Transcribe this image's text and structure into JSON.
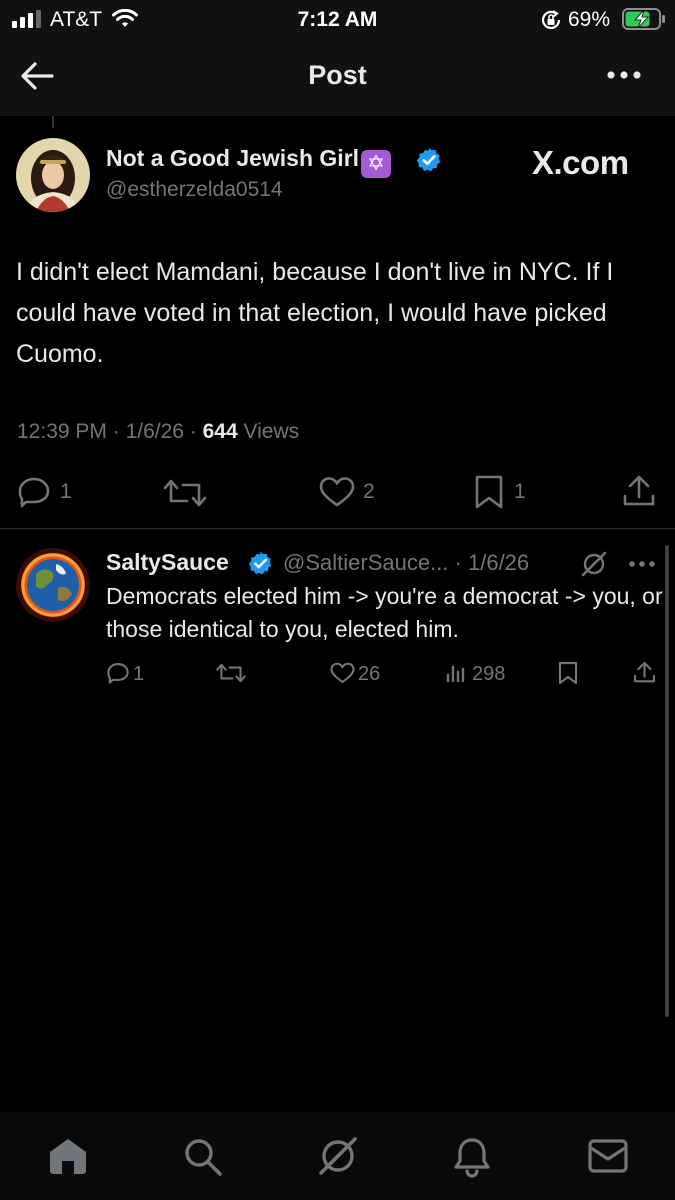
{
  "status_bar": {
    "carrier": "AT&T",
    "time": "7:12 AM",
    "battery_percent": "69%"
  },
  "header": {
    "title": "Post"
  },
  "post": {
    "display_name": "Not a Good Jewish Girl",
    "name_emoji": "✡",
    "handle": "@estherzelda0514",
    "watermark": "X.com",
    "text": "I didn't elect Mamdani, because I don't live in NYC. If I could have voted in that election, I would have picked Cuomo.",
    "time": "12:39 PM",
    "date": "1/6/26",
    "views_count": "644",
    "views_label": "Views",
    "actions": {
      "replies": "1",
      "likes": "2",
      "bookmarks": "1"
    }
  },
  "reply": {
    "display_name": "SaltySauce",
    "handle": "@SaltierSauce...",
    "date": "1/6/26",
    "text": "Democrats elected him -> you're a democrat -> you, or those identical to you, elected him.",
    "actions": {
      "replies": "1",
      "likes": "26",
      "views": "298"
    }
  },
  "colors": {
    "background": "#000000",
    "text": "#e7e9ea",
    "muted": "#71767b",
    "verified": "#1d9bf0",
    "divider": "#2f3336"
  },
  "icons": [
    "signal-icon",
    "wifi-icon",
    "orientation-lock-icon",
    "battery-charging-icon",
    "back-arrow-icon",
    "more-icon",
    "verified-badge-icon",
    "reply-icon",
    "retweet-icon",
    "like-icon",
    "bookmark-icon",
    "share-icon",
    "grok-icon",
    "views-icon",
    "home-icon",
    "search-icon",
    "notifications-icon",
    "messages-icon"
  ]
}
